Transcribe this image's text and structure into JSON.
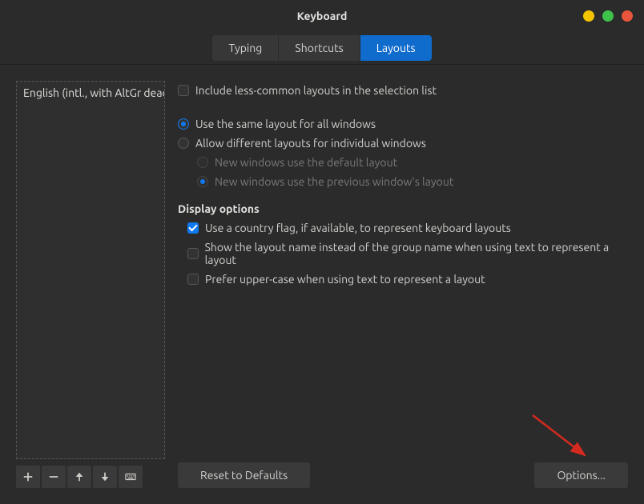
{
  "window": {
    "title": "Keyboard"
  },
  "tabs": [
    {
      "label": "Typing",
      "active": false
    },
    {
      "label": "Shortcuts",
      "active": false
    },
    {
      "label": "Layouts",
      "active": true
    }
  ],
  "layouts_list": [
    "English (intl., with AltGr dead keys)"
  ],
  "options": {
    "include_less_common": "Include less-common layouts in the selection list",
    "same_layout": "Use the same layout for all windows",
    "different_layouts": "Allow different layouts for individual windows",
    "new_default": "New windows use the default layout",
    "new_previous": "New windows use the previous window's layout"
  },
  "display_section": {
    "heading": "Display options",
    "use_flag": "Use a country flag, if available,  to represent keyboard layouts",
    "show_layout_name": "Show the layout name instead of the group name when using text to represent a layout",
    "prefer_uppercase": "Prefer upper-case when using text to represent a layout"
  },
  "buttons": {
    "reset": "Reset to Defaults",
    "options": "Options..."
  }
}
